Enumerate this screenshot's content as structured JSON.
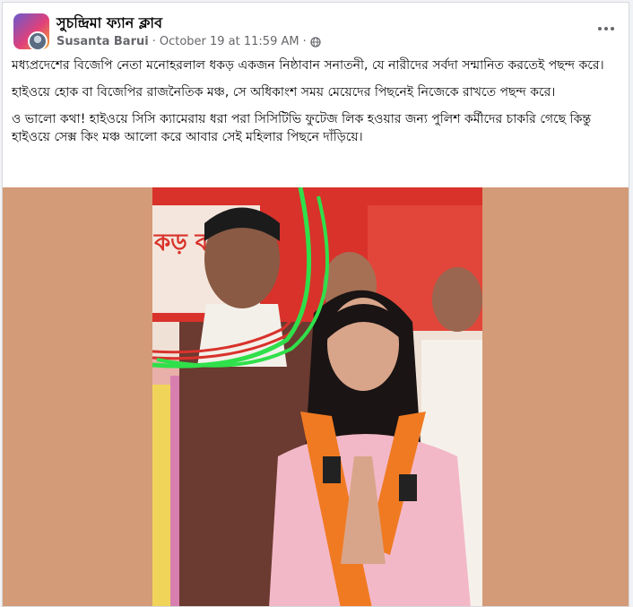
{
  "post": {
    "page_name": "সুচন্দ্রিমা ফ্যান ক্লাব",
    "author": "Susanta Barui",
    "separator": "·",
    "timestamp": "October 19 at 11:59 AM",
    "separator2": "·",
    "privacy_icon": "globe-icon",
    "more_icon": "more-options-icon",
    "paragraphs": [
      "মধ্যপ্রদেশের বিজেপি নেতা মনোহরলাল ধকড় একজন নিষ্ঠাবান সনাতনী, যে নারীদের সর্বদা সন্মানিত করতেই পছন্দ করে।",
      "হাইওয়ে হোক বা বিজেপির রাজনৈতিক মঞ্চ, সে অধিকাংশ সময় মেয়েদের পিছনেই নিজেকে রাখতে পছন্দ করে।",
      "ও ভালো কথা! হাইওয়ে সিসি ক্যামেরায় ধরা পরা সিসিটিভি ফুটেজ লিক হওয়ার জন্য পুলিশ কর্মীদের চাকরি গেছে কিন্তু হাইওয়ে সেক্স কিং মঞ্চ আলো করে আবার সেই মহিলার পিছনে দাঁড়িয়ে।"
    ],
    "banner_text": "কড় ব"
  },
  "colors": {
    "photo_matte": "#d39b77",
    "banner_red": "#d8322b",
    "saffron": "#f07a22",
    "highlight_green": "#2fe04a",
    "highlight_red": "#d8322b"
  }
}
